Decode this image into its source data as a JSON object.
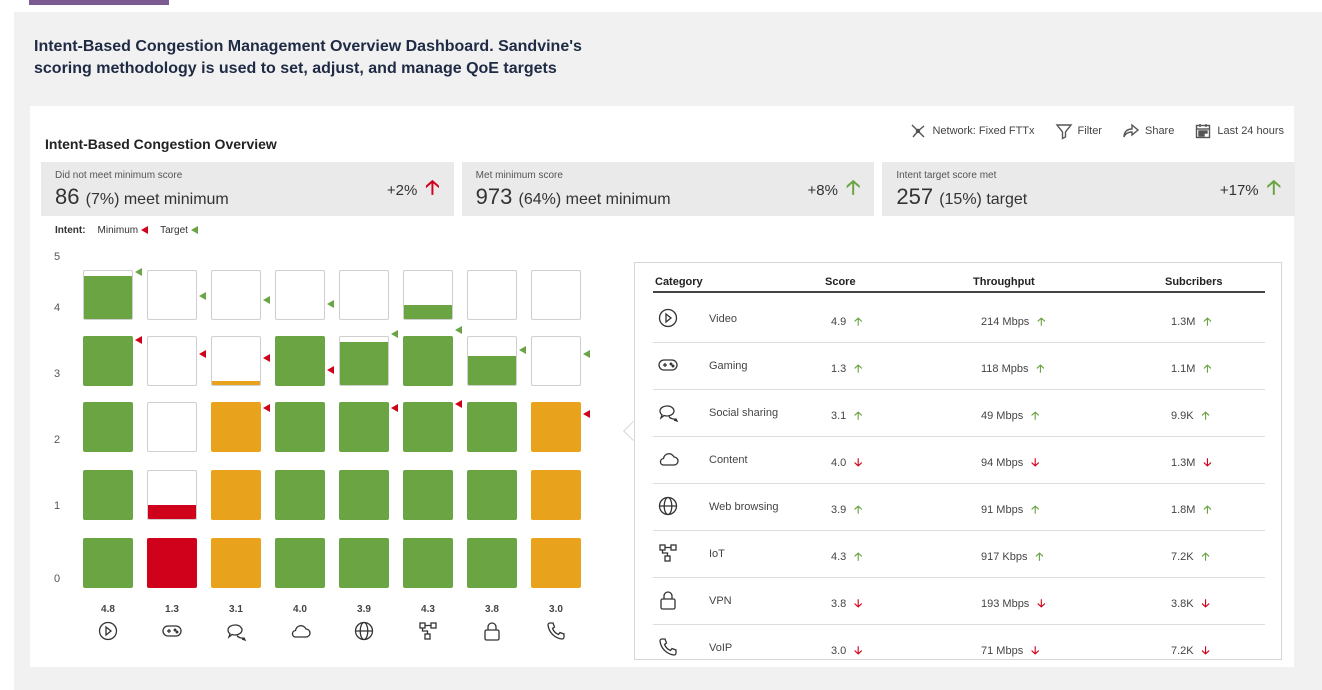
{
  "caption": {
    "line1": "Intent-Based Congestion Management Overview Dashboard. Sandvine's",
    "line2": "scoring methodology is used to set, adjust, and manage QoE targets"
  },
  "dashboard": {
    "title": "Intent-Based Congestion Overview",
    "toolbar": {
      "network": "Network: Fixed FTTx",
      "filter": "Filter",
      "share": "Share",
      "range": "Last 24 hours"
    },
    "stats": [
      {
        "label": "Did not meet minimum score",
        "value": "86",
        "sub": "(7%) meet minimum",
        "change": "+2%",
        "trend": "up-red"
      },
      {
        "label": "Met minimum score",
        "value": "973",
        "sub": "(64%) meet minimum",
        "change": "+8%",
        "trend": "up-green"
      },
      {
        "label": "Intent target score met",
        "value": "257",
        "sub": "(15%) target",
        "change": "+17%",
        "trend": "up-green"
      }
    ],
    "intent_legend": {
      "label": "Intent:",
      "minimum": "Minimum",
      "target": "Target"
    },
    "y_axis": [
      "5",
      "4",
      "3",
      "2",
      "1",
      "0"
    ],
    "column_scores": [
      "4.8",
      "1.3",
      "3.1",
      "4.0",
      "3.9",
      "4.3",
      "3.8",
      "3.0"
    ],
    "column_icons": [
      "play-icon",
      "gamepad-icon",
      "chat-icon",
      "cloud-icon",
      "globe-icon",
      "iot-icon",
      "lock-icon",
      "phone-icon"
    ],
    "colors": {
      "green": "#6aa443",
      "amber": "#e8a21c",
      "red": "#d0021b",
      "empty": "#ffffff"
    },
    "table": {
      "headers": {
        "category": "Category",
        "score": "Score",
        "throughput": "Throughput",
        "subscribers": "Subcribers"
      },
      "rows": [
        {
          "icon": "play-icon",
          "category": "Video",
          "score": "4.9",
          "score_trend": "up",
          "throughput": "214 Mbps",
          "tp_trend": "up",
          "subs": "1.3M",
          "subs_trend": "up"
        },
        {
          "icon": "gamepad-icon",
          "category": "Gaming",
          "score": "1.3",
          "score_trend": "up",
          "throughput": "118 Mpbs",
          "tp_trend": "up",
          "subs": "1.1M",
          "subs_trend": "up"
        },
        {
          "icon": "chat-icon",
          "category": "Social sharing",
          "score": "3.1",
          "score_trend": "up",
          "throughput": "49 Mbps",
          "tp_trend": "up",
          "subs": "9.9K",
          "subs_trend": "up"
        },
        {
          "icon": "cloud-icon",
          "category": "Content",
          "score": "4.0",
          "score_trend": "down",
          "throughput": "94 Mbps",
          "tp_trend": "down",
          "subs": "1.3M",
          "subs_trend": "down"
        },
        {
          "icon": "globe-icon",
          "category": "Web browsing",
          "score": "3.9",
          "score_trend": "up",
          "throughput": "91 Mbps",
          "tp_trend": "up",
          "subs": "1.8M",
          "subs_trend": "up"
        },
        {
          "icon": "iot-icon",
          "category": "IoT",
          "score": "4.3",
          "score_trend": "up",
          "throughput": "917 Kbps",
          "tp_trend": "up",
          "subs": "7.2K",
          "subs_trend": "up"
        },
        {
          "icon": "lock-icon",
          "category": "VPN",
          "score": "3.8",
          "score_trend": "down",
          "throughput": "193 Mbps",
          "tp_trend": "down",
          "subs": "3.8K",
          "subs_trend": "down"
        },
        {
          "icon": "phone-icon",
          "category": "VoIP",
          "score": "3.0",
          "score_trend": "down",
          "throughput": "71 Mbps",
          "tp_trend": "down",
          "subs": "7.2K",
          "subs_trend": "down"
        }
      ]
    }
  }
}
